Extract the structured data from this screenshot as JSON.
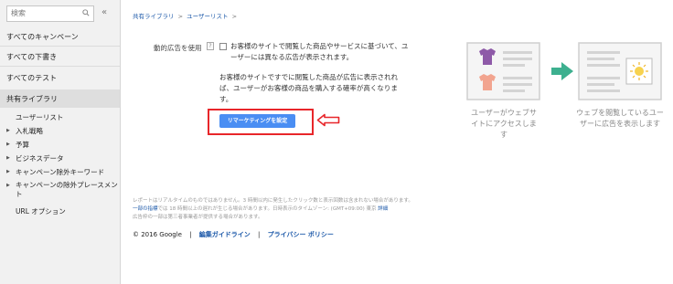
{
  "sidebar": {
    "search_placeholder": "検索",
    "collapse_label": "«",
    "items": [
      {
        "label": "すべてのキャンペーン"
      },
      {
        "label": "すべての下書き"
      },
      {
        "label": "すべてのテスト"
      },
      {
        "label": "共有ライブラリ"
      }
    ],
    "sub_items": [
      {
        "label": "ユーザーリスト"
      },
      {
        "label": "入札戦略"
      },
      {
        "label": "予算"
      },
      {
        "label": "ビジネスデータ"
      },
      {
        "label": "キャンペーン除外キーワード"
      },
      {
        "label": "キャンペーンの除外プレースメント"
      },
      {
        "label": "URL オプション"
      }
    ]
  },
  "breadcrumb": {
    "part1": "共有ライブラリ",
    "sep1": ">",
    "part2": "ユーザーリスト",
    "sep2": ">"
  },
  "main": {
    "label": "動的広告を使用",
    "help_label": "?",
    "desc1": "お客様のサイトで閲覧した商品やサービスに基づいて、ユーザーには異なる広告が表示されます。",
    "desc2": "お客様のサイトですでに閲覧した商品が広告に表示されれば、ユーザーがお客様の商品を購入する確率が高くなります。",
    "button_label": "リマーケティングを設定"
  },
  "illustration": {
    "caption_left": "ユーザーがウェブサイトにアクセスします",
    "caption_right": "ウェブを閲覧しているユーザーに広告を表示します"
  },
  "footer": {
    "line1": "レポートはリアルタイムのものではありません。3 時間以内に発生したクリック数と表示回数は含まれない場合があります。",
    "line2_link": "一部の指標",
    "line2_text": "では 18 時間以上の遅れが生じる場合があります。日時表示のタイムゾーン: (GMT+09:00) 東京",
    "line2_link2": "詳細",
    "line3": "広告枠の一部は第三者事業者が提供する場合があります。",
    "copyright": "© 2016 Google",
    "divider": "|",
    "link1": "編集ガイドライン",
    "link2": "プライバシー ポリシー"
  },
  "colors": {
    "accent": "#4a8ef3",
    "highlight_border": "#e8262a",
    "link": "#1a57a8"
  }
}
